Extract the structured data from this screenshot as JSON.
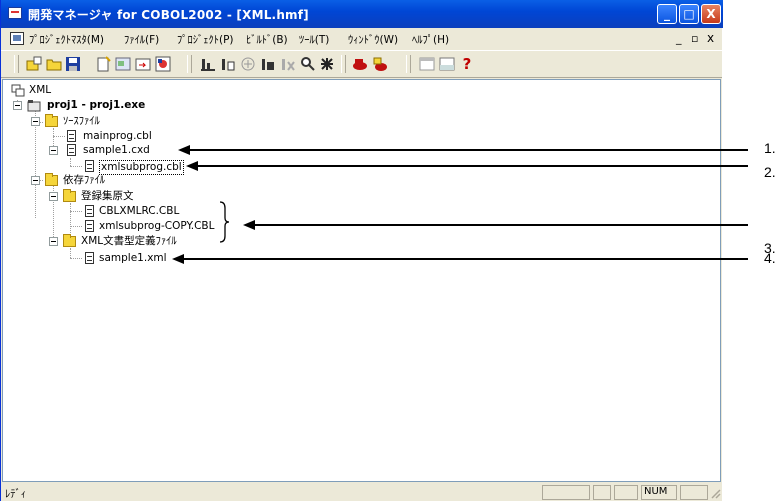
{
  "window": {
    "title": "開発マネージャ for COBOL2002 - [XML.hmf]",
    "caption_min": "_",
    "caption_max": "□",
    "caption_close": "X"
  },
  "menubar": {
    "items": [
      "ﾌﾟﾛｼﾞｪｸﾄﾏｽﾀ(M)",
      "ﾌｧｲﾙ(F)",
      "ﾌﾟﾛｼﾞｪｸﾄ(P)",
      "ﾋﾞﾙﾄﾞ(B)",
      "ﾂｰﾙ(T)",
      "ｳｨﾝﾄﾞｳ(W)",
      "ﾍﾙﾌﾟ(H)"
    ],
    "mdi_min": "_",
    "mdi_restore": "▫",
    "mdi_close": "x"
  },
  "toolbar": {
    "help_label": "?"
  },
  "tree": {
    "root": "XML",
    "project": "proj1 - proj1.exe",
    "source_folder": "ｿｰｽﾌｧｲﾙ",
    "source_files": [
      "mainprog.cbl",
      "sample1.cxd"
    ],
    "sub_file": "xmlsubprog.cbl",
    "dep_folder": "依存ﾌｧｲﾙ",
    "copy_folder": "登録集原文",
    "copy_files": [
      "CBLXMLRC.CBL",
      "xmlsubprog-COPY.CBL"
    ],
    "xml_folder": "XML文書型定義ﾌｧｲﾙ",
    "xml_file": "sample1.xml"
  },
  "statusbar": {
    "text": "ﾚﾃﾞｨ",
    "num": "NUM"
  },
  "callouts": [
    "1.",
    "2.",
    "3.",
    "4."
  ],
  "colors": {
    "titlebar": "#0b4fd8",
    "close_button": "#d44a26",
    "folder": "#f5d53a"
  }
}
